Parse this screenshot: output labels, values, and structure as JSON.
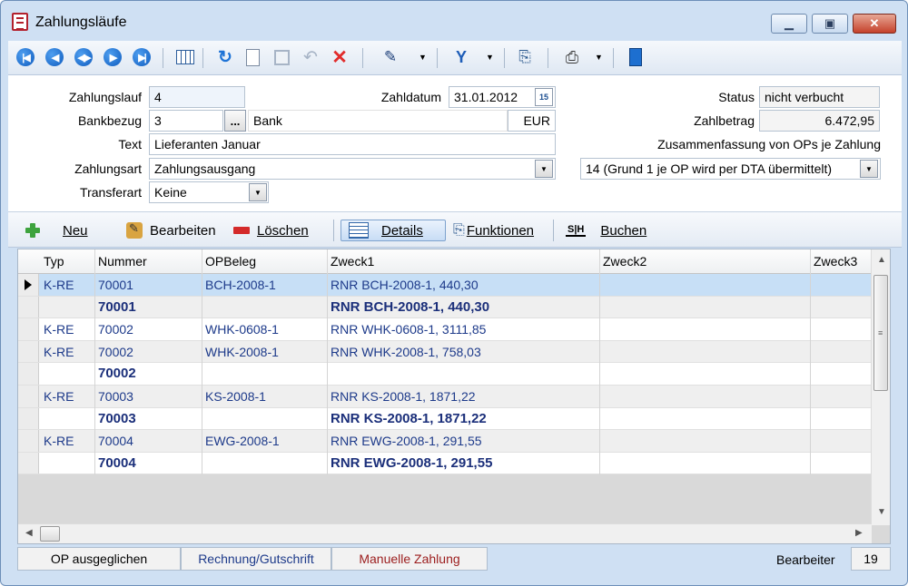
{
  "window": {
    "title": "Zahlungsläufe"
  },
  "toolbar": {
    "nav_first": "first-record",
    "nav_prev": "previous-record",
    "nav_mid": "record-list",
    "nav_next": "next-record",
    "nav_last": "last-record"
  },
  "form": {
    "zahlungslauf_label": "Zahlungslauf",
    "zahlungslauf_value": "4",
    "bankbezug_label": "Bankbezug",
    "bankbezug_value": "3",
    "bankbezug_button": "...",
    "bank_name": "Bank",
    "currency": "EUR",
    "text_label": "Text",
    "text_value": "Lieferanten Januar",
    "zahlungsart_label": "Zahlungsart",
    "zahlungsart_value": "Zahlungsausgang",
    "transferart_label": "Transferart",
    "transferart_value": "Keine",
    "zahldatum_label": "Zahldatum",
    "zahldatum_value": "31.01.2012",
    "status_label": "Status",
    "status_value": "nicht verbucht",
    "zahlbetrag_label": "Zahlbetrag",
    "zahlbetrag_value": "6.472,95",
    "zusammenfassung_label": "Zusammenfassung von OPs je Zahlung",
    "zusammenfassung_value": "14 (Grund 1 je OP wird per DTA übermittelt)"
  },
  "actions": {
    "neu": "Neu",
    "bearbeiten": "Bearbeiten",
    "loeschen": "Löschen",
    "details": "Details",
    "funktionen": "Funktionen",
    "buchen": "Buchen",
    "buchen_icon_text": "S|H"
  },
  "table": {
    "headers": [
      "Typ",
      "Nummer",
      "OPBeleg",
      "Zweck1",
      "Zweck2",
      "Zweck3"
    ],
    "rows": [
      {
        "typ": "K-RE",
        "nummer": "70001",
        "opbeleg": "BCH-2008-1",
        "zweck1": "RNR BCH-2008-1, 440,30",
        "summary": false,
        "selected": true
      },
      {
        "typ": "",
        "nummer": "70001",
        "opbeleg": "",
        "zweck1": "RNR BCH-2008-1, 440,30",
        "summary": true,
        "selected": false
      },
      {
        "typ": "K-RE",
        "nummer": "70002",
        "opbeleg": "WHK-0608-1",
        "zweck1": "RNR WHK-0608-1, 3111,85",
        "summary": false,
        "selected": false
      },
      {
        "typ": "K-RE",
        "nummer": "70002",
        "opbeleg": "WHK-2008-1",
        "zweck1": "RNR WHK-2008-1, 758,03",
        "summary": false,
        "selected": false
      },
      {
        "typ": "",
        "nummer": "70002",
        "opbeleg": "",
        "zweck1": "",
        "summary": true,
        "selected": false
      },
      {
        "typ": "K-RE",
        "nummer": "70003",
        "opbeleg": "KS-2008-1",
        "zweck1": "RNR KS-2008-1, 1871,22",
        "summary": false,
        "selected": false
      },
      {
        "typ": "",
        "nummer": "70003",
        "opbeleg": "",
        "zweck1": "RNR KS-2008-1, 1871,22",
        "summary": true,
        "selected": false
      },
      {
        "typ": "K-RE",
        "nummer": "70004",
        "opbeleg": "EWG-2008-1",
        "zweck1": "RNR EWG-2008-1, 291,55",
        "summary": false,
        "selected": false
      },
      {
        "typ": "",
        "nummer": "70004",
        "opbeleg": "",
        "zweck1": "RNR EWG-2008-1, 291,55",
        "summary": true,
        "selected": false
      }
    ]
  },
  "statusbar": {
    "op_ausgeglichen": "OP ausgeglichen",
    "rechnung_gutschrift": "Rechnung/Gutschrift",
    "manuelle_zahlung": "Manuelle Zahlung",
    "bearbeiter_label": "Bearbeiter",
    "bearbeiter_value": "19"
  },
  "colors": {
    "rechnung_text": "#1d3a8a",
    "manuelle_text": "#9b1c1c",
    "selected_row": "#c7dff6"
  }
}
